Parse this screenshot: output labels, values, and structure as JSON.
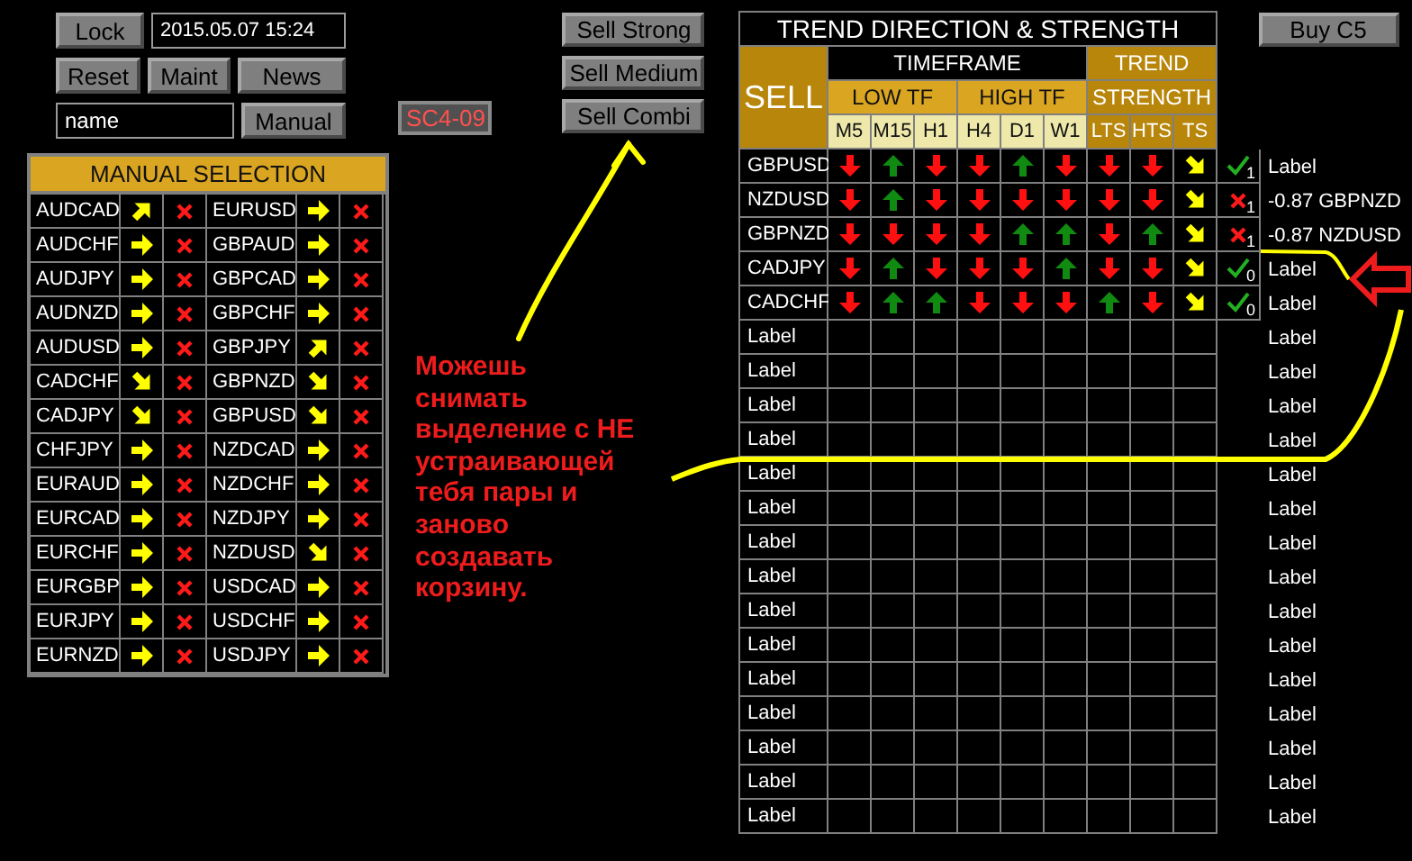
{
  "controls": {
    "lock": "Lock",
    "datetime": "2015.05.07 15:24",
    "reset": "Reset",
    "maint": "Maint",
    "news": "News",
    "name_value": "name",
    "manual": "Manual"
  },
  "code_badge": "SC4-09",
  "sell_buttons": [
    "Sell Strong",
    "Sell Medium",
    "Sell Combi"
  ],
  "manual_selection": {
    "title": "MANUAL SELECTION",
    "pairs": [
      {
        "pair": "AUDCAD",
        "kind": "rising"
      },
      {
        "pair": "EURUSD",
        "kind": "flat"
      },
      {
        "pair": "AUDCHF",
        "kind": "flat"
      },
      {
        "pair": "GBPAUD",
        "kind": "flat"
      },
      {
        "pair": "AUDJPY",
        "kind": "flat"
      },
      {
        "pair": "GBPCAD",
        "kind": "flat"
      },
      {
        "pair": "AUDNZD",
        "kind": "flat"
      },
      {
        "pair": "GBPCHF",
        "kind": "flat"
      },
      {
        "pair": "AUDUSD",
        "kind": "flat"
      },
      {
        "pair": "GBPJPY",
        "kind": "rising"
      },
      {
        "pair": "CADCHF",
        "kind": "falling"
      },
      {
        "pair": "GBPNZD",
        "kind": "falling"
      },
      {
        "pair": "CADJPY",
        "kind": "falling"
      },
      {
        "pair": "GBPUSD",
        "kind": "falling"
      },
      {
        "pair": "CHFJPY",
        "kind": "flat"
      },
      {
        "pair": "NZDCAD",
        "kind": "flat"
      },
      {
        "pair": "EURAUD",
        "kind": "flat"
      },
      {
        "pair": "NZDCHF",
        "kind": "flat"
      },
      {
        "pair": "EURCAD",
        "kind": "flat"
      },
      {
        "pair": "NZDJPY",
        "kind": "flat"
      },
      {
        "pair": "EURCHF",
        "kind": "flat"
      },
      {
        "pair": "NZDUSD",
        "kind": "falling"
      },
      {
        "pair": "EURGBP",
        "kind": "flat"
      },
      {
        "pair": "USDCAD",
        "kind": "flat"
      },
      {
        "pair": "EURJPY",
        "kind": "flat"
      },
      {
        "pair": "USDCHF",
        "kind": "flat"
      },
      {
        "pair": "EURNZD",
        "kind": "flat"
      },
      {
        "pair": "USDJPY",
        "kind": "flat"
      }
    ]
  },
  "annotation": "Можешь\nснимать\nвыделение с НЕ\nустраивающей\nтебя пары и\nзаново\nсоздавать\nкорзину.",
  "trend": {
    "title": "TREND DIRECTION & STRENGTH",
    "buy_button": "Buy C5",
    "side": "SELL",
    "group": "TIMEFRAME",
    "strength_title": "TREND",
    "strength_subtitle": "STRENGTH",
    "bands": [
      "LOW TF",
      "HIGH TF"
    ],
    "timeframes": [
      "M5",
      "M15",
      "H1",
      "H4",
      "D1",
      "W1"
    ],
    "strength_columns": [
      "LTS",
      "HTS",
      "TS"
    ],
    "rows": [
      {
        "pair": "GBPUSD",
        "signals": [
          {
            "kind": "down"
          },
          {
            "kind": "up"
          },
          {
            "kind": "down"
          },
          {
            "kind": "down"
          },
          {
            "kind": "up"
          },
          {
            "kind": "down"
          },
          {
            "kind": "down"
          },
          {
            "kind": "down"
          },
          {
            "kind": "falling"
          }
        ],
        "status": {
          "passed": true,
          "count": "1"
        }
      },
      {
        "pair": "NZDUSD",
        "signals": [
          {
            "kind": "down"
          },
          {
            "kind": "up"
          },
          {
            "kind": "down"
          },
          {
            "kind": "down"
          },
          {
            "kind": "down"
          },
          {
            "kind": "down"
          },
          {
            "kind": "down"
          },
          {
            "kind": "down"
          },
          {
            "kind": "falling"
          }
        ],
        "status": {
          "passed": false,
          "count": "1"
        }
      },
      {
        "pair": "GBPNZD",
        "signals": [
          {
            "kind": "down"
          },
          {
            "kind": "down"
          },
          {
            "kind": "down"
          },
          {
            "kind": "down"
          },
          {
            "kind": "up"
          },
          {
            "kind": "up"
          },
          {
            "kind": "down"
          },
          {
            "kind": "up"
          },
          {
            "kind": "falling"
          }
        ],
        "status": {
          "passed": false,
          "count": "1"
        }
      },
      {
        "pair": "CADJPY",
        "signals": [
          {
            "kind": "down"
          },
          {
            "kind": "up"
          },
          {
            "kind": "down"
          },
          {
            "kind": "down"
          },
          {
            "kind": "down"
          },
          {
            "kind": "up"
          },
          {
            "kind": "down"
          },
          {
            "kind": "down"
          },
          {
            "kind": "falling"
          }
        ],
        "status": {
          "passed": true,
          "count": "0"
        }
      },
      {
        "pair": "CADCHF",
        "signals": [
          {
            "kind": "down"
          },
          {
            "kind": "up"
          },
          {
            "kind": "up"
          },
          {
            "kind": "down"
          },
          {
            "kind": "down"
          },
          {
            "kind": "down"
          },
          {
            "kind": "up"
          },
          {
            "kind": "down"
          },
          {
            "kind": "falling"
          }
        ],
        "status": {
          "passed": true,
          "count": "0"
        }
      },
      {
        "pair": "Label"
      },
      {
        "pair": "Label"
      },
      {
        "pair": "Label"
      },
      {
        "pair": "Label"
      },
      {
        "pair": "Label"
      },
      {
        "pair": "Label"
      },
      {
        "pair": "Label"
      },
      {
        "pair": "Label"
      },
      {
        "pair": "Label"
      },
      {
        "pair": "Label"
      },
      {
        "pair": "Label"
      },
      {
        "pair": "Label"
      },
      {
        "pair": "Label"
      },
      {
        "pair": "Label"
      },
      {
        "pair": "Label"
      }
    ],
    "side_labels": [
      "Label",
      "-0.87 GBPNZD",
      "-0.87 NZDUSD",
      "Label",
      "Label",
      "Label",
      "Label",
      "Label",
      "Label",
      "Label",
      "Label",
      "Label",
      "Label",
      "Label",
      "Label",
      "Label",
      "Label",
      "Label",
      "Label",
      "Label"
    ]
  }
}
